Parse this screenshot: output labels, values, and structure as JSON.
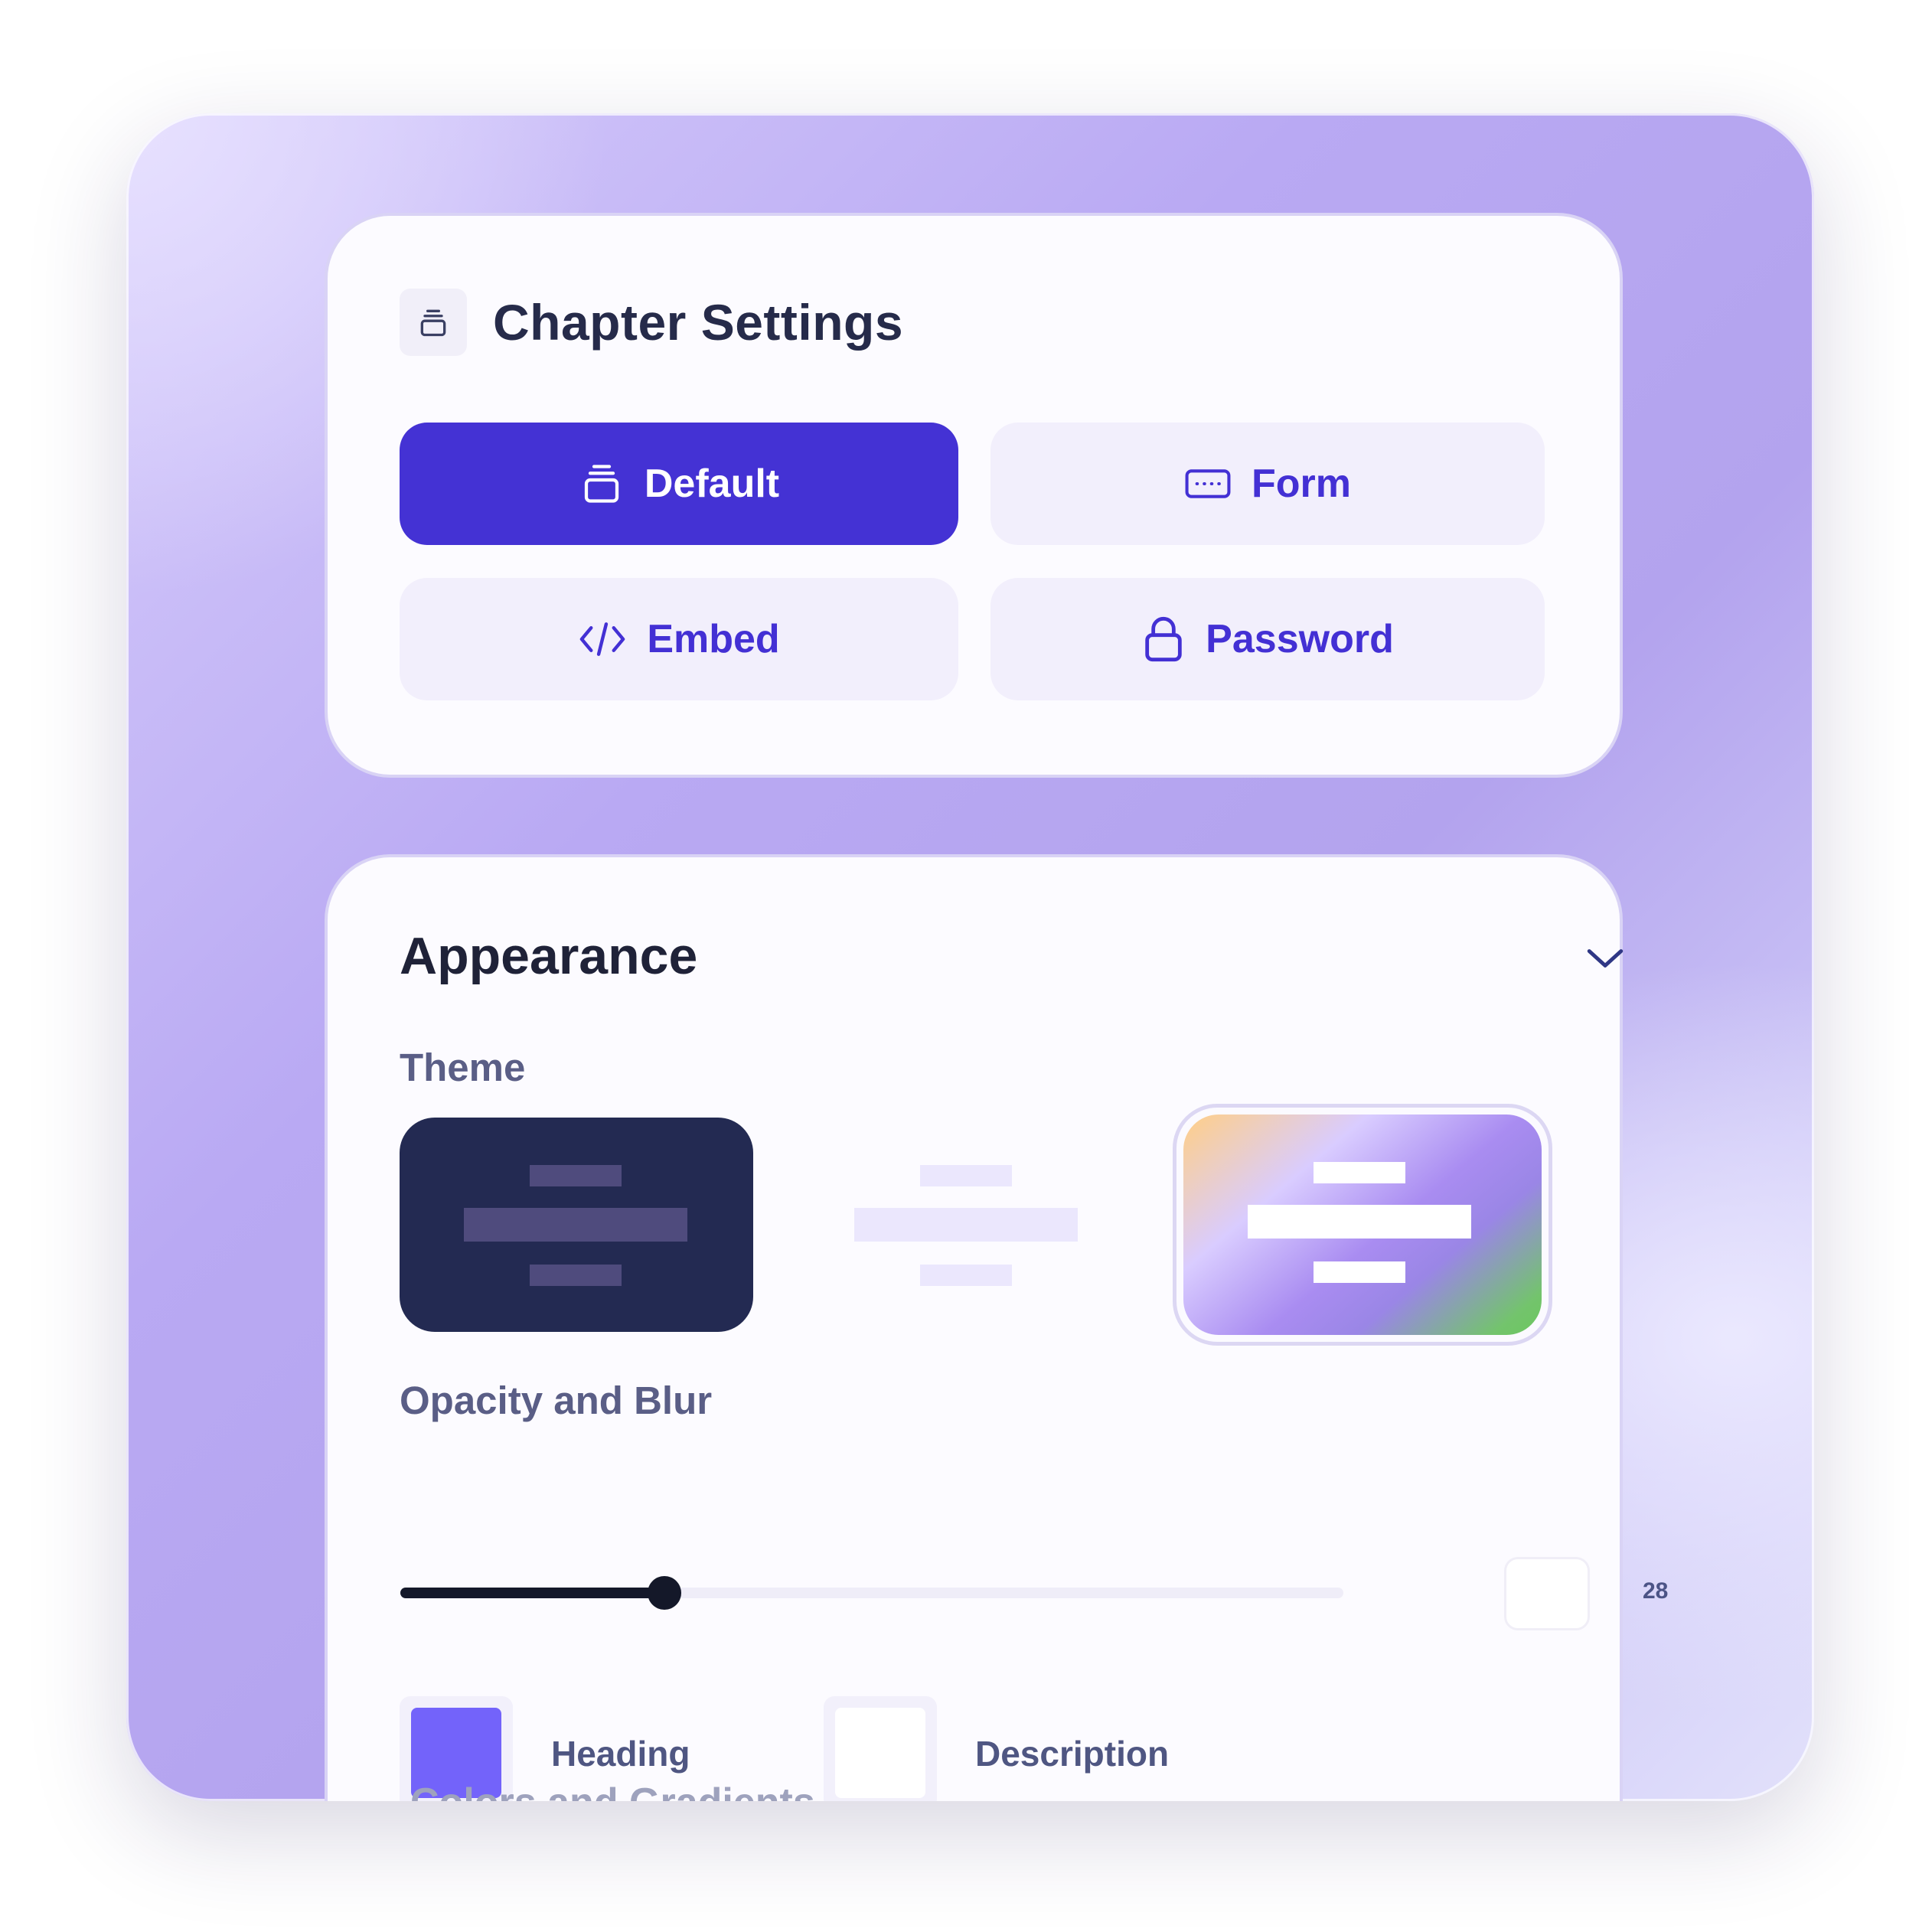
{
  "settings": {
    "title": "Chapter Settings",
    "title_icon": "stack-icon",
    "options": [
      {
        "label": "Default",
        "icon": "stack-icon",
        "active": true
      },
      {
        "label": "Form",
        "icon": "keyboard-icon",
        "active": false
      },
      {
        "label": "Embed",
        "icon": "code-icon",
        "active": false
      },
      {
        "label": "Password",
        "icon": "lock-icon",
        "active": false
      }
    ]
  },
  "appearance": {
    "title": "Appearance",
    "theme_label": "Theme",
    "themes": [
      "dark",
      "light",
      "gradient"
    ],
    "selected_theme": "gradient",
    "opacity_label": "Opacity and Blur",
    "opacity_value": "28",
    "heading_label": "Heading",
    "heading_color": "#7363fa",
    "description_label": "Description",
    "description_color": "#ffffff",
    "next_section_partial": "Colors and Gradients"
  },
  "colors": {
    "accent": "#4432d4",
    "accent_soft": "#f2effc",
    "text_dark": "#262b4a"
  }
}
